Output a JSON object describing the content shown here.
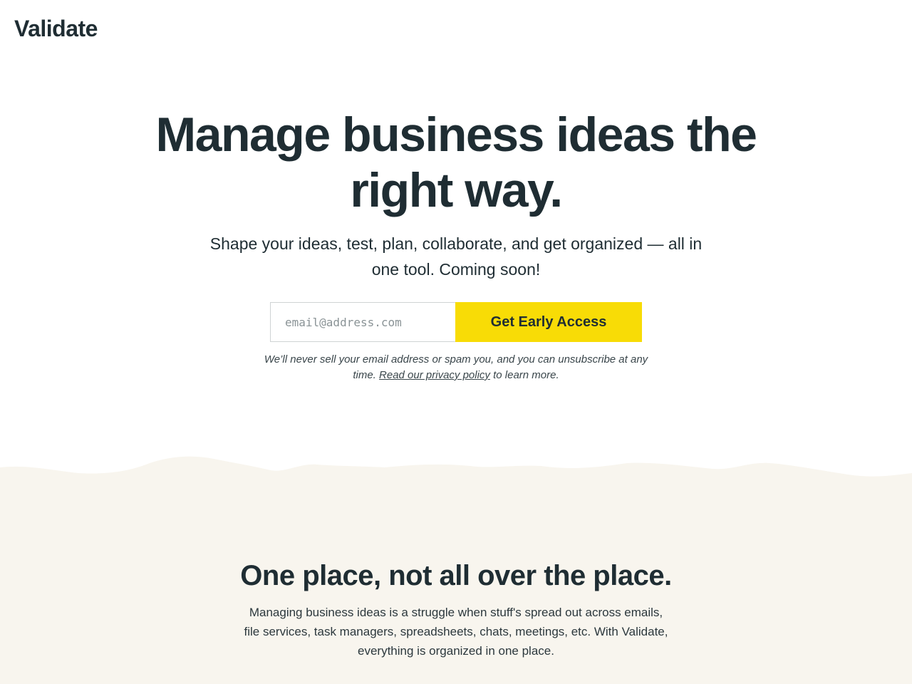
{
  "brand": {
    "logo_text": "Validate"
  },
  "hero": {
    "title": "Manage business ideas the right way.",
    "subtitle": "Shape your ideas, test, plan, collaborate, and get organized — all in one tool. Coming soon!"
  },
  "signup": {
    "email_placeholder": "email@address.com",
    "email_value": "",
    "button_label": "Get Early Access",
    "button_color": "#f8dc06"
  },
  "disclaimer": {
    "text_before": "We’ll never sell your email address or spam you, and you can unsubscribe at any time. ",
    "link_text": "Read our privacy policy",
    "text_after": " to learn more."
  },
  "feature_section": {
    "title": "One place, not all over the place.",
    "body": "Managing business ideas is a struggle when stuff's spread out across emails, file services, task managers, spreadsheets, chats, meetings, etc. With Validate, everything is organized in one place.",
    "background_color": "#f8f5ee"
  },
  "colors": {
    "text": "#1f2d33",
    "accent": "#f8dc06"
  }
}
